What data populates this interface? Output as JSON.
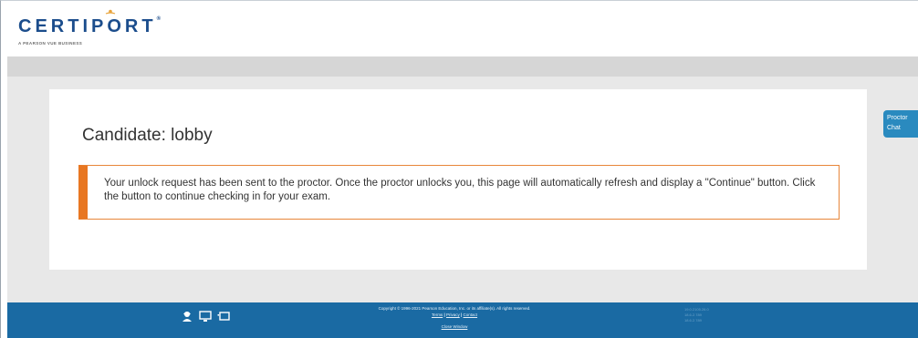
{
  "brand": {
    "name": "CERTIPORT",
    "tm": "®",
    "tagline": "A PEARSON VUE BUSINESS"
  },
  "main": {
    "title": "Candidate: lobby",
    "notice": "Your unlock request has been sent to the proctor. Once the proctor unlocks you, this page will automatically refresh and display a \"Continue\" button. Click the button to continue checking in for your exam."
  },
  "proctor_chat": {
    "line1": "Proctor",
    "line2": "Chat"
  },
  "footer": {
    "copyright": "Copyright © 1996-2021 Pearson Education, Inc. or its affiliate(s). All rights reserved.",
    "links": [
      "Terms",
      "Privacy",
      "Contact"
    ],
    "separator": "|",
    "close_window": "Close Window",
    "versions": [
      "19.0.2105.26.0",
      "18.6.2.789",
      "18.6.2.789"
    ],
    "icons": [
      "user-headset-icon",
      "computer-icon",
      "window-icon"
    ]
  },
  "colors": {
    "brand_blue": "#1b4d8c",
    "accent_orange": "#e87722",
    "footer_blue": "#1a6aa3",
    "chat_blue": "#2a8abf"
  }
}
